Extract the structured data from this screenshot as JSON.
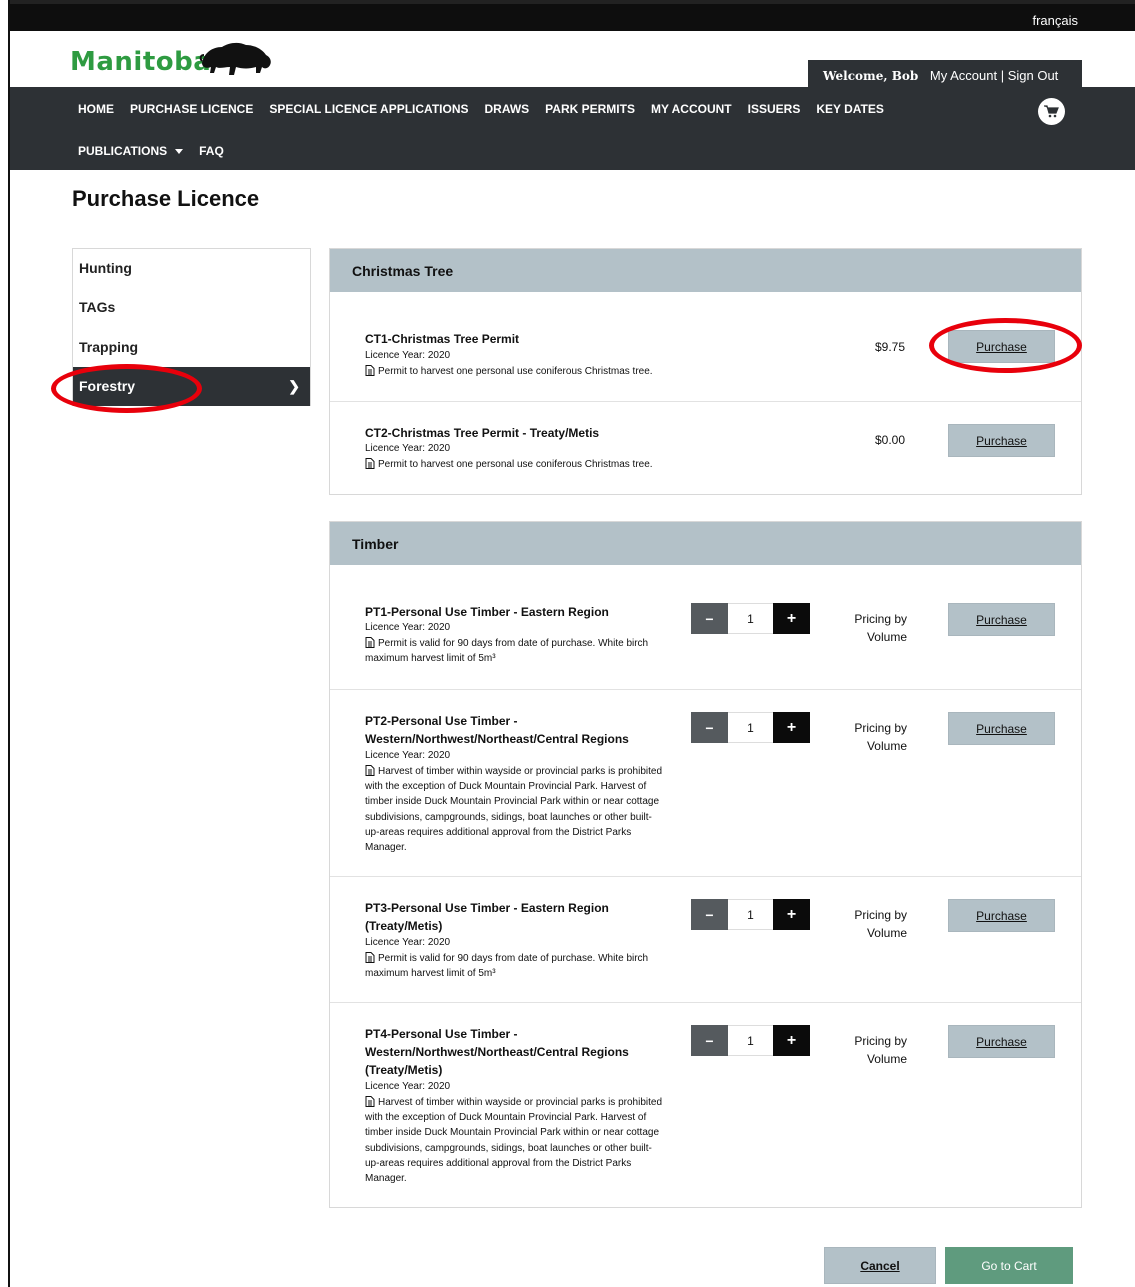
{
  "language_link": "français",
  "brand": {
    "logo_text": "Manitoba"
  },
  "account": {
    "welcome": "Welcome, Bob",
    "my_account": "My Account",
    "separator": "|",
    "sign_out": "Sign Out"
  },
  "nav": {
    "row1": [
      "HOME",
      "PURCHASE LICENCE",
      "SPECIAL LICENCE APPLICATIONS",
      "DRAWS",
      "PARK PERMITS",
      "MY ACCOUNT",
      "ISSUERS",
      "KEY DATES"
    ],
    "row2": [
      "PUBLICATIONS",
      "FAQ"
    ],
    "cart_icon": "shopping-cart-icon"
  },
  "page_title": "Purchase Licence",
  "sidebar": {
    "items": [
      {
        "label": "Hunting"
      },
      {
        "label": "TAGs"
      },
      {
        "label": "Trapping"
      },
      {
        "label": "Forestry",
        "active": true
      }
    ]
  },
  "sections": [
    {
      "title": "Christmas Tree",
      "items": [
        {
          "title": "CT1-Christmas Tree Permit",
          "year": "Licence Year: 2020",
          "desc": "Permit to harvest one personal use coniferous Christmas tree.",
          "price": "$9.75",
          "button": "Purchase"
        },
        {
          "title": "CT2-Christmas Tree Permit - Treaty/Metis",
          "year": "Licence Year: 2020",
          "desc": "Permit to harvest one personal use coniferous Christmas tree.",
          "price": "$0.00",
          "button": "Purchase"
        }
      ]
    },
    {
      "title": "Timber",
      "items": [
        {
          "title_lines": [
            "PT1-Personal Use Timber - Eastern Region"
          ],
          "year": "Licence Year: 2020",
          "desc_lines": [
            "Permit is valid for 90 days from date of purchase. White birch",
            "maximum harvest limit of 5m³"
          ],
          "qty": "1",
          "pricing_lines": [
            "Pricing by",
            "Volume"
          ],
          "button": "Purchase"
        },
        {
          "title_lines": [
            "PT2-Personal Use Timber -",
            "Western/Northwest/Northeast/Central Regions"
          ],
          "year": "Licence Year: 2020",
          "desc_lines": [
            "Harvest of timber within wayside or provincial parks is prohibited",
            "with the exception of Duck Mountain Provincial Park. Harvest of",
            "timber inside Duck Mountain Provincial Park within or near cottage",
            "subdivisions, campgrounds, sidings, boat launches or other built-",
            "up-areas requires additional approval from the District Parks",
            "Manager."
          ],
          "qty": "1",
          "pricing_lines": [
            "Pricing by",
            "Volume"
          ],
          "button": "Purchase"
        },
        {
          "title_lines": [
            "PT3-Personal Use Timber - Eastern Region",
            "(Treaty/Metis)"
          ],
          "year": "Licence Year: 2020",
          "desc_lines": [
            "Permit is valid for 90 days from date of purchase. White birch",
            "maximum harvest limit of 5m³"
          ],
          "qty": "1",
          "pricing_lines": [
            "Pricing by",
            "Volume"
          ],
          "button": "Purchase"
        },
        {
          "title_lines": [
            "PT4-Personal Use Timber -",
            "Western/Northwest/Northeast/Central Regions",
            "(Treaty/Metis)"
          ],
          "year": "Licence Year: 2020",
          "desc_lines": [
            "Harvest of timber within wayside or provincial parks is prohibited",
            "with the exception of Duck Mountain Provincial Park. Harvest of",
            "timber inside Duck Mountain Provincial Park within or near cottage",
            "subdivisions, campgrounds, sidings, boat launches or other built-",
            "up-areas requires additional approval from the District Parks",
            "Manager."
          ],
          "qty": "1",
          "pricing_lines": [
            "Pricing by",
            "Volume"
          ],
          "button": "Purchase"
        }
      ]
    }
  ],
  "stepper": {
    "minus": "−",
    "plus": "+"
  },
  "footer_buttons": {
    "cancel": "Cancel",
    "go_to_cart": "Go to Cart"
  },
  "colors": {
    "brand_green": "#2e9b41",
    "nav_bg": "#2d3135",
    "section_head": "#b3c1c8",
    "button": "#b3c1c8",
    "cart_button": "#5f9b7e",
    "highlight": "#e8000b"
  }
}
